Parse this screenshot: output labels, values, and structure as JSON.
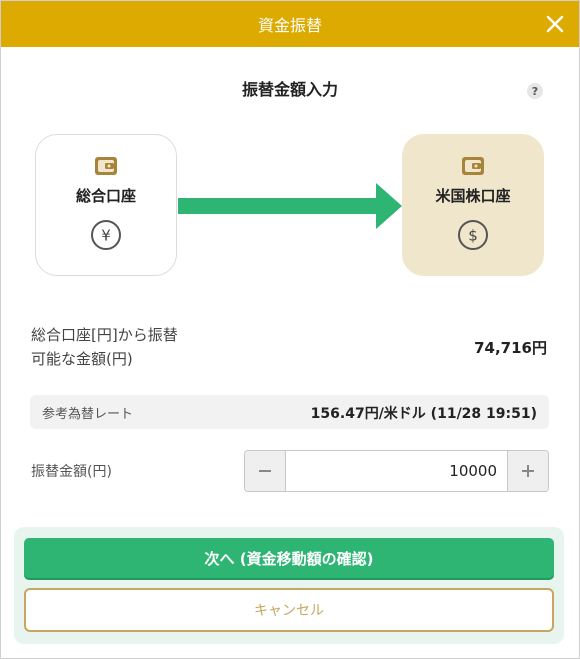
{
  "dialog": {
    "title": "資金振替",
    "subtitle": "振替金額入力",
    "help_symbol": "?"
  },
  "from_account": {
    "label": "総合口座",
    "currency_icon": "yen-icon",
    "currency_symbol": "¥"
  },
  "to_account": {
    "label": "米国株口座",
    "currency_icon": "dollar-icon",
    "currency_symbol": "$"
  },
  "available": {
    "label_line1": "総合口座[円]から振替",
    "label_line2": "可能な金額(円)",
    "value": "74,716円"
  },
  "rate": {
    "label": "参考為替レート",
    "value": "156.47円/米ドル (11/28 19:51)"
  },
  "amount": {
    "label": "振替金額(円)",
    "value": "10000"
  },
  "buttons": {
    "next": "次へ (資金移動額の確認)",
    "cancel": "キャンセル"
  },
  "colors": {
    "header": "#dcaa00",
    "primary": "#2eb573",
    "arrow": "#2eb573",
    "gold": "#c7a662",
    "target_card": "#efe6cc"
  }
}
